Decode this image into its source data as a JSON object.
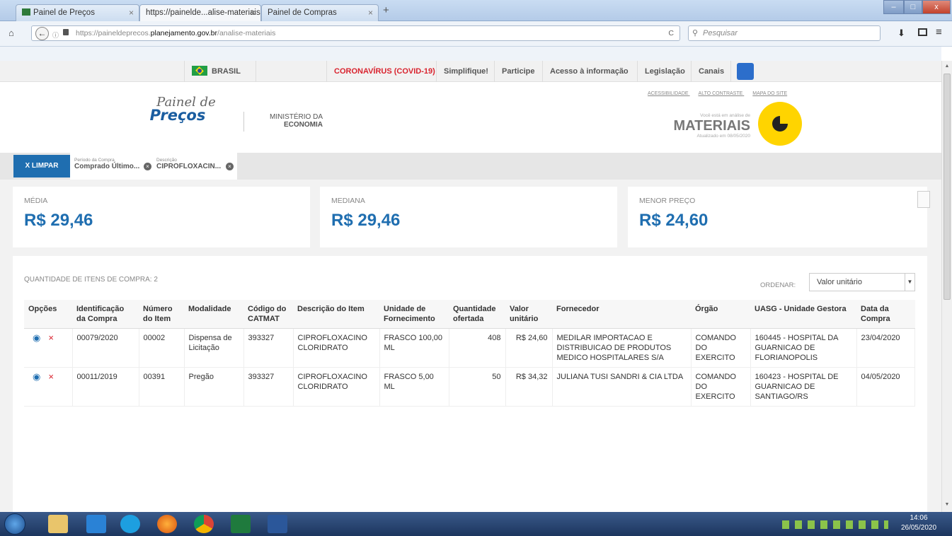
{
  "browser": {
    "tabs": [
      {
        "label": "Painel de Preços",
        "close": "×"
      },
      {
        "label": "https://painelde...alise-materiais",
        "close": "×"
      },
      {
        "label": "Painel de Compras",
        "close": "×"
      }
    ],
    "new_tab": "+",
    "url_prefix": "https://paineldeprecos.",
    "url_domain": "planejamento.gov.br",
    "url_path": "/analise-materiais",
    "search_placeholder": "Pesquisar",
    "reload": "C",
    "window_min": "–",
    "window_max": "□",
    "window_close": "x"
  },
  "govbar": {
    "brasil": "BRASIL",
    "items": [
      "CORONAVÍRUS (COVID-19)",
      "Simplifique!",
      "Participe",
      "Acesso à informação",
      "Legislação",
      "Canais"
    ]
  },
  "header": {
    "logo_line1": "Painel de",
    "logo_line2": "Preços",
    "ministry_line1": "MINISTÉRIO DA",
    "ministry_line2": "ECONOMIA",
    "links": [
      "ACESSIBILIDADE",
      "ALTO CONTRASTE",
      "MAPA DO SITE"
    ],
    "context_small": "Você está em análise de",
    "context_big": "MATERIAIS",
    "updated": "Atualizado em 08/05/2020"
  },
  "filters": {
    "clear_label": "X  LIMPAR",
    "chips": [
      {
        "label": "Período da Compra",
        "value": "Comprado Último..."
      },
      {
        "label": "Descrição",
        "value": "CIPROFLOXACIN..."
      }
    ]
  },
  "stats": [
    {
      "label": "MÉDIA",
      "value": "R$ 29,46"
    },
    {
      "label": "MEDIANA",
      "value": "R$ 29,46"
    },
    {
      "label": "MENOR PREÇO",
      "value": "R$ 24,60"
    }
  ],
  "results": {
    "count_label": "QUANTIDADE DE ITENS DE COMPRA: 2",
    "sort_label": "ORDENAR:",
    "sort_value": "Valor unitário",
    "columns": [
      "Opções",
      "Identificação da Compra",
      "Número do Item",
      "Modalidade",
      "Código do CATMAT",
      "Descrição do Item",
      "Unidade de Fornecimento",
      "Quantidade ofertada",
      "Valor unitário",
      "Fornecedor",
      "Órgão",
      "UASG - Unidade Gestora",
      "Data da Compra"
    ],
    "rows": [
      [
        "",
        "00079/2020",
        "00002",
        "Dispensa de Licitação",
        "393327",
        "CIPROFLOXACINO CLORIDRATO",
        "FRASCO 100,00 ML",
        "408",
        "R$ 24,60",
        "MEDILAR IMPORTACAO E DISTRIBUICAO DE PRODUTOS MEDICO HOSPITALARES S/A",
        "COMANDO DO EXERCITO",
        "160445 - HOSPITAL DA GUARNICAO DE FLORIANOPOLIS",
        "23/04/2020"
      ],
      [
        "",
        "00011/2019",
        "00391",
        "Pregão",
        "393327",
        "CIPROFLOXACINO CLORIDRATO",
        "FRASCO 5,00 ML",
        "50",
        "R$ 34,32",
        "JULIANA TUSI SANDRI & CIA LTDA",
        "COMANDO DO EXERCITO",
        "160423 - HOSPITAL DE GUARNICAO DE SANTIAGO/RS",
        "04/05/2020"
      ]
    ]
  },
  "taskbar": {
    "time": "14:06",
    "date": "26/05/2020"
  },
  "colors": {
    "accent": "#1f6eb0",
    "covid": "#d9232e",
    "yellow": "#ffd400"
  }
}
